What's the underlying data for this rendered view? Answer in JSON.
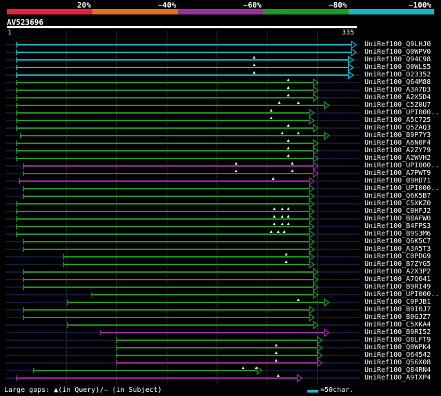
{
  "legend": {
    "labels": [
      "20%",
      "~40%",
      "~60%",
      "~80%",
      "~100%"
    ],
    "colors": [
      "#e8203a",
      "#e07020",
      "#9c2fa0",
      "#1e9a1e",
      "#17b4c4"
    ]
  },
  "query": {
    "id": "AV523696",
    "start": "1",
    "end": "335"
  },
  "hits": [
    {
      "name": "UniRef100_Q9LHJ0",
      "color": "#17b4c4",
      "start": 1,
      "end": 335,
      "gaps": []
    },
    {
      "name": "UniRef100_Q0WPV0",
      "color": "#17b4c4",
      "start": 1,
      "end": 335,
      "gaps": []
    },
    {
      "name": "UniRef100_Q94C98",
      "color": "#17b4c4",
      "start": 1,
      "end": 332,
      "gaps": [
        238
      ]
    },
    {
      "name": "UniRef100_Q0WLS5",
      "color": "#17b4c4",
      "start": 1,
      "end": 332,
      "gaps": [
        238
      ]
    },
    {
      "name": "UniRef100_O23352",
      "color": "#17b4c4",
      "start": 1,
      "end": 332,
      "gaps": [
        238
      ]
    },
    {
      "name": "UniRef100_Q64M88",
      "color": "#1e9a1e",
      "start": 1,
      "end": 297,
      "gaps": [
        272
      ]
    },
    {
      "name": "UniRef100_A3A7D3",
      "color": "#1e9a1e",
      "start": 1,
      "end": 297,
      "gaps": [
        272
      ]
    },
    {
      "name": "UniRef100_A2X5D4",
      "color": "#1e9a1e",
      "start": 1,
      "end": 297,
      "gaps": [
        272
      ]
    },
    {
      "name": "UniRef100_C5Z0U7",
      "color": "#1e9a1e",
      "start": 1,
      "end": 308,
      "gaps": [
        263,
        282
      ]
    },
    {
      "name": "UniRef100_UPI000..",
      "color": "#1e9a1e",
      "start": 1,
      "end": 293,
      "gaps": [
        255
      ]
    },
    {
      "name": "UniRef100_A5C725",
      "color": "#1e9a1e",
      "start": 1,
      "end": 293,
      "gaps": [
        255
      ]
    },
    {
      "name": "UniRef100_Q5ZAQ3",
      "color": "#1e9a1e",
      "start": 1,
      "end": 297,
      "gaps": [
        272
      ]
    },
    {
      "name": "UniRef100_B9P7Y3",
      "color": "#1e9a1e",
      "start": 5,
      "end": 308,
      "gaps": [
        266,
        282
      ]
    },
    {
      "name": "UniRef100_A6N0F4",
      "color": "#1e9a1e",
      "start": 1,
      "end": 297,
      "gaps": [
        272
      ]
    },
    {
      "name": "UniRef100_A2ZY79",
      "color": "#1e9a1e",
      "start": 1,
      "end": 297,
      "gaps": [
        272
      ]
    },
    {
      "name": "UniRef100_A2WVH2",
      "color": "#1e9a1e",
      "start": 1,
      "end": 297,
      "gaps": [
        272
      ]
    },
    {
      "name": "UniRef100_UPI000..",
      "color": "#9c2fa0",
      "start": 8,
      "end": 297,
      "gaps": [
        220,
        276
      ]
    },
    {
      "name": "UniRef100_A7PWT9",
      "color": "#9c2fa0",
      "start": 8,
      "end": 297,
      "gaps": [
        220,
        276
      ]
    },
    {
      "name": "UniRef100_B9HD71",
      "color": "#9c2fa0",
      "start": 4,
      "end": 293,
      "gaps": [
        257
      ]
    },
    {
      "name": "UniRef100_UPI000..",
      "color": "#1e9a1e",
      "start": 8,
      "end": 293,
      "gaps": []
    },
    {
      "name": "UniRef100_Q6K5B7",
      "color": "#1e9a1e",
      "start": 8,
      "end": 293,
      "gaps": []
    },
    {
      "name": "UniRef100_C5XKZ0",
      "color": "#1e9a1e",
      "start": 1,
      "end": 293,
      "gaps": []
    },
    {
      "name": "UniRef100_C0HFJ2",
      "color": "#1e9a1e",
      "start": 1,
      "end": 293,
      "gaps": [
        258,
        266,
        272
      ]
    },
    {
      "name": "UniRef100_B8AFW0",
      "color": "#1e9a1e",
      "start": 1,
      "end": 293,
      "gaps": [
        258,
        266,
        272
      ]
    },
    {
      "name": "UniRef100_B4FPS3",
      "color": "#1e9a1e",
      "start": 1,
      "end": 293,
      "gaps": [
        258,
        266,
        272
      ]
    },
    {
      "name": "UniRef100_B9S3M6",
      "color": "#1e9a1e",
      "start": 1,
      "end": 293,
      "gaps": [
        255,
        262,
        268
      ]
    },
    {
      "name": "UniRef100_Q6K5C7",
      "color": "#1e9a1e",
      "start": 8,
      "end": 293,
      "gaps": []
    },
    {
      "name": "UniRef100_A3A5T3",
      "color": "#1e9a1e",
      "start": 8,
      "end": 293,
      "gaps": []
    },
    {
      "name": "UniRef100_C0PDG9",
      "color": "#1e9a1e",
      "start": 48,
      "end": 293,
      "gaps": [
        270
      ]
    },
    {
      "name": "UniRef100_B7ZYG5",
      "color": "#1e9a1e",
      "start": 48,
      "end": 293,
      "gaps": [
        270
      ]
    },
    {
      "name": "UniRef100_A2X3P2",
      "color": "#1e9a1e",
      "start": 8,
      "end": 297,
      "gaps": []
    },
    {
      "name": "UniRef100_A7Q641",
      "color": "#1e9a1e",
      "start": 8,
      "end": 297,
      "gaps": []
    },
    {
      "name": "UniRef100_B9RI49",
      "color": "#1e9a1e",
      "start": 8,
      "end": 297,
      "gaps": []
    },
    {
      "name": "UniRef100_UPI000..",
      "color": "#1e9a1e",
      "start": 76,
      "end": 297,
      "gaps": []
    },
    {
      "name": "UniRef100_C0PJB1",
      "color": "#1e9a1e",
      "start": 52,
      "end": 308,
      "gaps": [
        282
      ]
    },
    {
      "name": "UniRef100_B9I0J7",
      "color": "#1e9a1e",
      "start": 8,
      "end": 293,
      "gaps": []
    },
    {
      "name": "UniRef100_B9GJZ7",
      "color": "#1e9a1e",
      "start": 8,
      "end": 293,
      "gaps": []
    },
    {
      "name": "UniRef100_C5XKA4",
      "color": "#1e9a1e",
      "start": 52,
      "end": 297,
      "gaps": []
    },
    {
      "name": "UniRef100_B9RI52",
      "color": "#9c2fa0",
      "start": 85,
      "end": 308,
      "gaps": []
    },
    {
      "name": "UniRef100_Q8LFT9",
      "color": "#1e9a1e",
      "start": 101,
      "end": 301,
      "gaps": []
    },
    {
      "name": "UniRef100_Q0WPK4",
      "color": "#1e9a1e",
      "start": 101,
      "end": 301,
      "gaps": [
        260
      ]
    },
    {
      "name": "UniRef100_O64542",
      "color": "#1e9a1e",
      "start": 101,
      "end": 301,
      "gaps": [
        260
      ]
    },
    {
      "name": "UniRef100_Q56X08",
      "color": "#9c2fa0",
      "start": 101,
      "end": 301,
      "gaps": [
        260
      ]
    },
    {
      "name": "UniRef100_Q84RN4",
      "color": "#1e9a1e",
      "start": 18,
      "end": 241,
      "gaps": [
        227,
        240
      ]
    },
    {
      "name": "UniRef100_A9TXP4",
      "color": "#9c2fa0",
      "start": 1,
      "end": 281,
      "gaps": [
        262
      ]
    }
  ],
  "footer": {
    "gaps_legend": "Large gaps: ▲(in Query)/– (in Subject)",
    "scale_label": "=50char."
  }
}
